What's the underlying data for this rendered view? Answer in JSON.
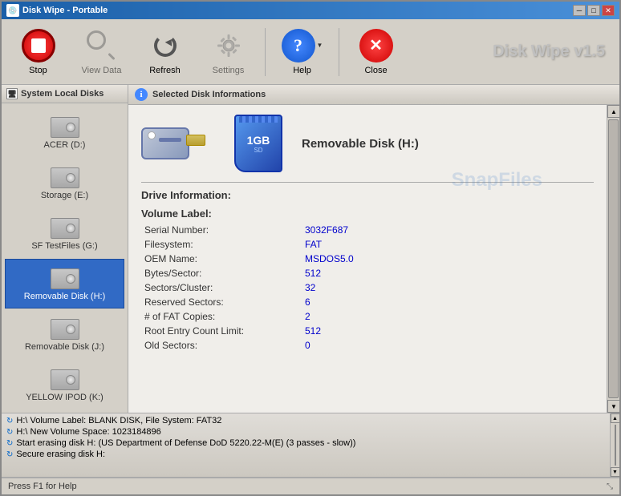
{
  "window": {
    "title": "Disk Wipe - Portable",
    "app_title": "Disk Wipe v1.5"
  },
  "toolbar": {
    "stop_label": "Stop",
    "view_data_label": "View Data",
    "refresh_label": "Refresh",
    "settings_label": "Settings",
    "help_label": "Help",
    "close_label": "Close"
  },
  "sidebar": {
    "header": "System Local Disks",
    "items": [
      {
        "label": "ACER (D:)",
        "selected": false
      },
      {
        "label": "Storage (E:)",
        "selected": false
      },
      {
        "label": "SF TestFiles (G:)",
        "selected": false
      },
      {
        "label": "Removable Disk (H:)",
        "selected": true
      },
      {
        "label": "Removable Disk (J:)",
        "selected": false
      },
      {
        "label": "YELLOW IPOD (K:)",
        "selected": false
      }
    ]
  },
  "content": {
    "header": "Selected Disk Informations",
    "disk_name": "Removable Disk  (H:)",
    "watermark": "SnapFiles",
    "section_title": "Drive Information:",
    "subsection_title": "Volume Label:",
    "fields": [
      {
        "label": "Serial Number:",
        "value": "3032F687"
      },
      {
        "label": "Filesystem:",
        "value": "FAT"
      },
      {
        "label": "OEM Name:",
        "value": "MSDOS5.0"
      },
      {
        "label": "Bytes/Sector:",
        "value": "512"
      },
      {
        "label": "Sectors/Cluster:",
        "value": "32"
      },
      {
        "label": "Reserved Sectors:",
        "value": "6"
      },
      {
        "label": "# of FAT Copies:",
        "value": "2"
      },
      {
        "label": "Root Entry Count Limit:",
        "value": "512"
      },
      {
        "label": "Old Sectors:",
        "value": "0"
      }
    ]
  },
  "log": {
    "lines": [
      "H:\\ Volume Label: BLANK DISK, File System: FAT32",
      "H:\\ New Volume Space: 1023184896",
      "Start erasing disk H: (US Department of Defense DoD 5220.22-M(E) (3 passes - slow))",
      "Secure erasing disk H:"
    ]
  },
  "bottom_bar": {
    "help_text": "Press F1 for Help"
  }
}
